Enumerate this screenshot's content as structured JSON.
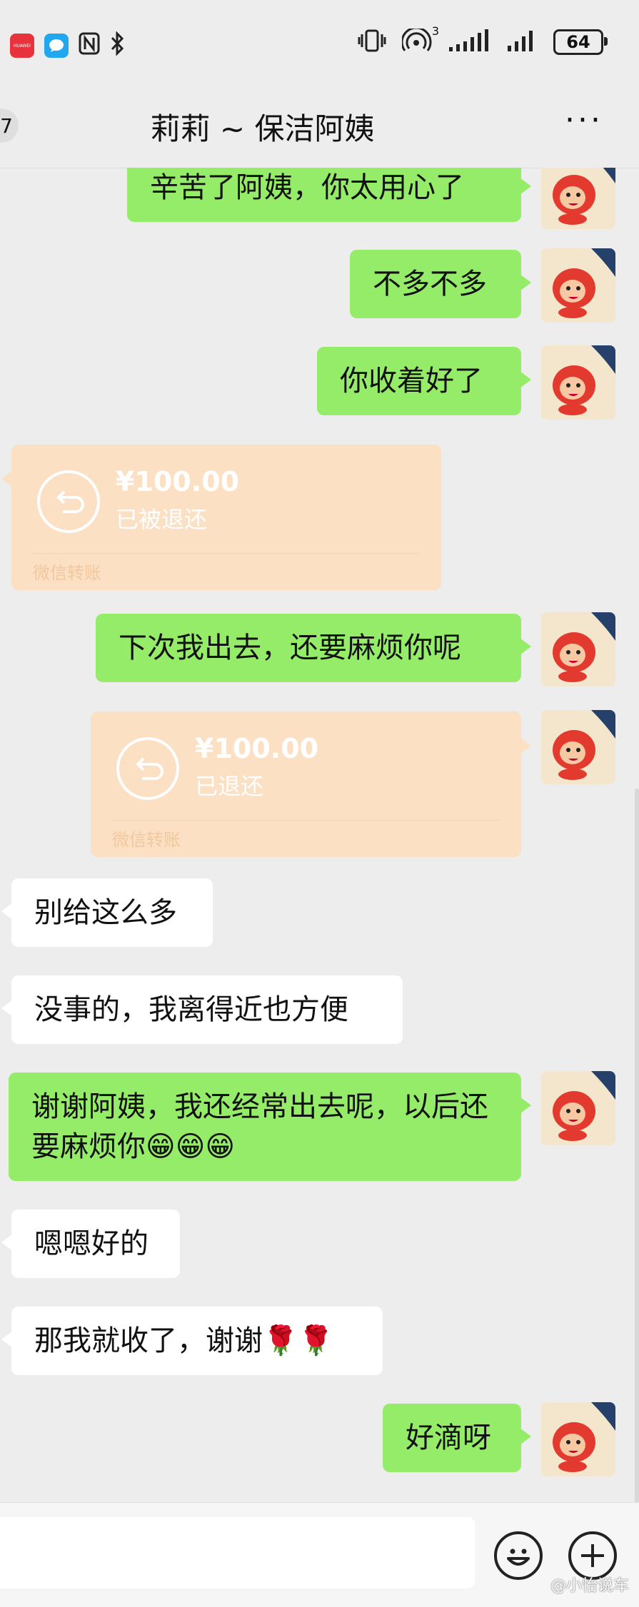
{
  "statusbar": {
    "battery": "64",
    "signal_superscript": "3",
    "app_icons": [
      "huawei-appgallery-icon",
      "message-icon",
      "nfc-icon",
      "bluetooth-icon"
    ],
    "app_gallery_label": "HUAWEI"
  },
  "header": {
    "back_count": "7",
    "title": "莉莉 ~ 保洁阿姨",
    "more": "···"
  },
  "messages": [
    {
      "side": "out",
      "text": "辛苦了阿姨，你太用心了"
    },
    {
      "side": "out",
      "text": "不多不多"
    },
    {
      "side": "out",
      "text": "你收着好了"
    },
    {
      "side": "in",
      "type": "transfer",
      "amount": "¥100.00",
      "status": "已被退还",
      "footer": "微信转账"
    },
    {
      "side": "out",
      "text": "下次我出去，还要麻烦你呢"
    },
    {
      "side": "out",
      "type": "transfer",
      "amount": "¥100.00",
      "status": "已退还",
      "footer": "微信转账"
    },
    {
      "side": "in",
      "text": "别给这么多"
    },
    {
      "side": "in",
      "text": "没事的，我离得近也方便"
    },
    {
      "side": "out",
      "text": "谢谢阿姨，我还经常出去呢，以后还要麻烦你😁😁😁"
    },
    {
      "side": "in",
      "text": "嗯嗯好的"
    },
    {
      "side": "in",
      "text": "那我就收了，谢谢🌹🌹"
    },
    {
      "side": "out",
      "text": "好滴呀"
    }
  ],
  "input_bar": {
    "watermark": "@小怡说车"
  },
  "colors": {
    "outgoing_bubble": "#95ec69",
    "incoming_bubble": "#ffffff",
    "transfer_card": "#fbe0c3",
    "background": "#ededed"
  }
}
